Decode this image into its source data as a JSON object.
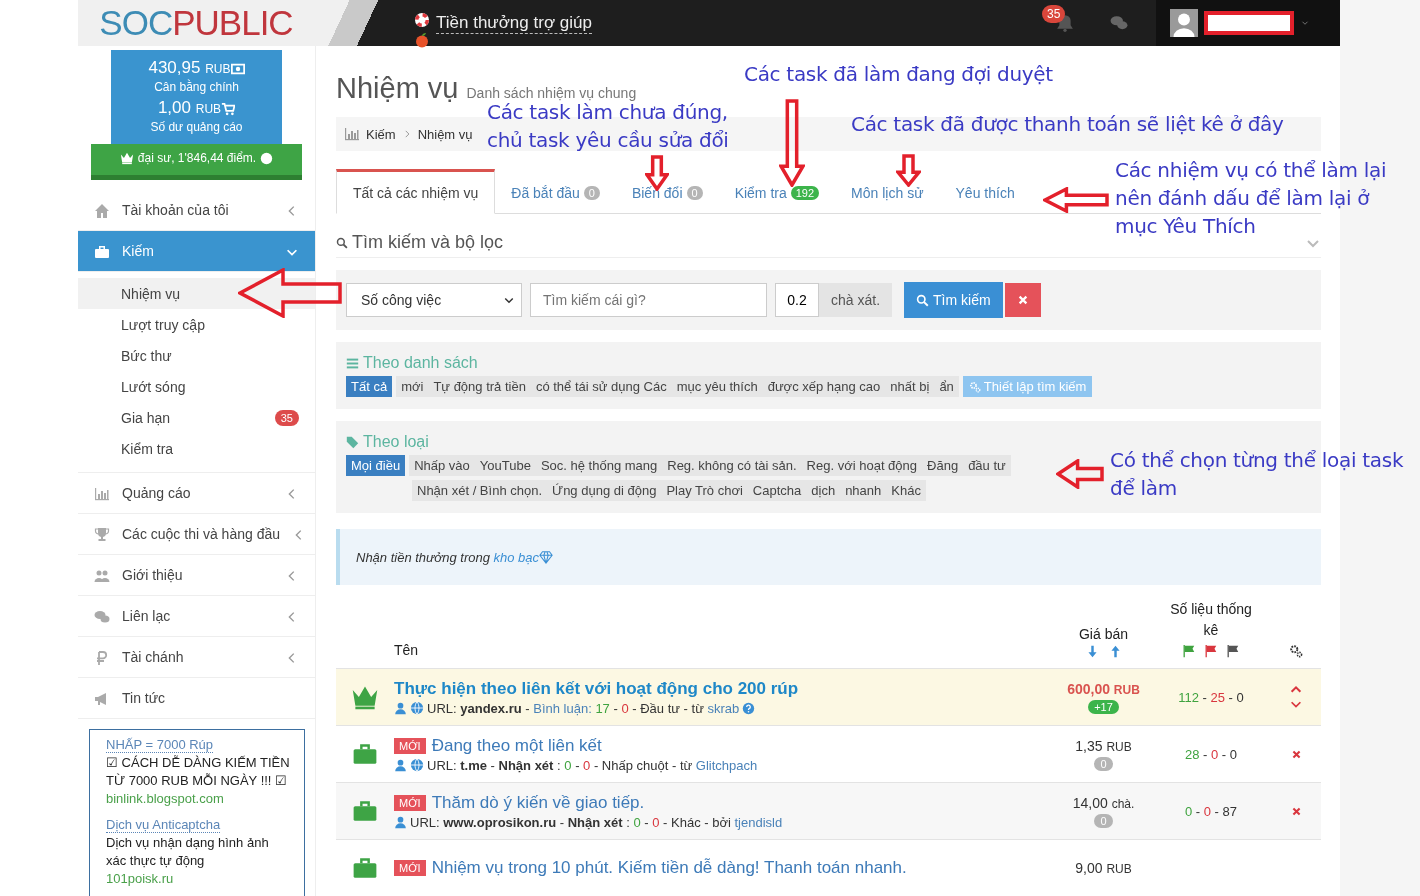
{
  "header": {
    "logo_left": "SOC",
    "logo_right": "PUBLIC",
    "bonus_link": "Tiền thưởng trợ giúp",
    "notification_count": "35"
  },
  "balance": {
    "main_amount": "430,95",
    "main_currency": "RUB",
    "main_label": "Cân bằng chính",
    "ad_amount": "1,00",
    "ad_currency": "RUB",
    "ad_label": "Số dư quảng cáo",
    "rank": "đại sư, 1'846,44 điểm."
  },
  "sidebar": {
    "items": [
      {
        "label": "Tài khoản của tôi",
        "kind": "group",
        "expanded": false,
        "selected": false
      },
      {
        "label": "Kiếm",
        "kind": "group",
        "expanded": true,
        "selected": true,
        "children": [
          {
            "label": "Nhiệm vụ",
            "selected": true
          },
          {
            "label": "Lượt truy cập",
            "selected": false
          },
          {
            "label": "Bức thư",
            "selected": false
          },
          {
            "label": "Lướt sóng",
            "selected": false
          },
          {
            "label": "Gia hạn",
            "selected": false,
            "badge": "35"
          },
          {
            "label": "Kiểm tra",
            "selected": false
          }
        ]
      },
      {
        "label": "Quảng cáo",
        "kind": "group",
        "expanded": false,
        "selected": false
      },
      {
        "label": "Các cuộc thi và hàng đầu",
        "kind": "group",
        "expanded": false,
        "selected": false
      },
      {
        "label": "Giới thiệu",
        "kind": "group",
        "expanded": false,
        "selected": false
      },
      {
        "label": "Liên lạc",
        "kind": "group",
        "expanded": false,
        "selected": false
      },
      {
        "label": "Tài chánh",
        "kind": "group",
        "expanded": false,
        "selected": false
      },
      {
        "label": "Tin tức",
        "kind": "link",
        "selected": false
      }
    ],
    "ads": [
      {
        "title": "NHẤP = 7000 Rúp",
        "body": "☑ CÁCH DỄ DÀNG KIẾM TIỀN TỪ 7000 RUB MỖI NGÀY !!! ☑",
        "url": "binlink.blogspot.com"
      },
      {
        "title": "Dịch vụ Anticaptcha",
        "body": "Dịch vụ nhận dạng hình ảnh xác thực tự động",
        "url": "101poisk.ru"
      }
    ]
  },
  "page": {
    "title": "Nhiệm vụ",
    "subtitle": "Danh sách nhiệm vụ chung",
    "breadcrumb": [
      "Kiếm",
      "Nhiệm vụ"
    ]
  },
  "tabs": [
    {
      "label": "Tất cả các nhiệm vụ",
      "selected": true
    },
    {
      "label": "Đã bắt đầu",
      "selected": false,
      "badge": {
        "text": "0",
        "color": "#b5b5b5"
      }
    },
    {
      "label": "Biến đổi",
      "selected": false,
      "badge": {
        "text": "0",
        "color": "#b5b5b5"
      }
    },
    {
      "label": "Kiểm tra",
      "selected": false,
      "badge": {
        "text": "192",
        "color": "#3cb44b"
      }
    },
    {
      "label": "Môn lịch sử",
      "selected": false
    },
    {
      "label": "Yêu thích",
      "selected": false
    }
  ],
  "search": {
    "title": "Tìm kiếm và bộ lọc",
    "select_value": "Số công việc",
    "placeholder": "Tìm kiếm cái gì?",
    "amount": "0.2",
    "unit": "chà xát.",
    "button": "Tìm kiếm"
  },
  "list_filter": {
    "title": "Theo danh sách",
    "options": [
      {
        "label": "Tất cả",
        "selected": true
      },
      {
        "label": "mới",
        "selected": false
      },
      {
        "label": "Tự động trả tiền",
        "selected": false
      },
      {
        "label": "có thể tái sử dụng Các",
        "selected": false
      },
      {
        "label": "mục yêu thích",
        "selected": false
      },
      {
        "label": "được xếp hạng cao",
        "selected": false
      },
      {
        "label": "nhất bị",
        "selected": false
      },
      {
        "label": "ẩn",
        "selected": false
      }
    ],
    "settings_button": "Thiết lập tìm kiếm"
  },
  "type_filter": {
    "title": "Theo loại",
    "option_rows": [
      [
        {
          "label": "Mọi điều",
          "selected": true
        },
        {
          "label": "Nhấp vào",
          "selected": false
        },
        {
          "label": "YouTube",
          "selected": false
        },
        {
          "label": "Soc. hệ thống mang",
          "selected": false
        },
        {
          "label": "Reg. không có tài sản.",
          "selected": false
        },
        {
          "label": "Reg. với hoạt động",
          "selected": false
        },
        {
          "label": "Đăng",
          "selected": false
        },
        {
          "label": "đầu tư",
          "selected": false
        }
      ],
      [
        {
          "label": "Nhận xét / Bình chọn.",
          "selected": false
        },
        {
          "label": "Ứng dụng di động",
          "selected": false
        },
        {
          "label": "Play Trò chơi",
          "selected": false
        },
        {
          "label": "Captcha",
          "selected": false
        },
        {
          "label": "dịch",
          "selected": false
        },
        {
          "label": "nhanh",
          "selected": false
        },
        {
          "label": "Khác",
          "selected": false
        }
      ]
    ]
  },
  "notice": {
    "text": "Nhận tiền thưởng trong ",
    "link": "kho bạc"
  },
  "table": {
    "columns": [
      "Tên",
      "Giá bán",
      "Số liệu thống kê"
    ],
    "rows": [
      {
        "kind": "premium",
        "title": "Thực hiện theo liên kết với hoạt động cho 200 rúp",
        "website_icon": true,
        "help_icon": true,
        "meta": [
          {
            "text": "URL: ",
            "kind": "text"
          },
          {
            "text": "yandex.ru",
            "kind": "bold"
          },
          {
            "text": " - ",
            "kind": "text"
          },
          {
            "text": "Bình luận: ",
            "kind": "link"
          },
          {
            "text": "17",
            "kind": "good"
          },
          {
            "text": " - ",
            "kind": "text"
          },
          {
            "text": "0",
            "kind": "bad"
          },
          {
            "text": " - Đầu tư - từ ",
            "kind": "text"
          },
          {
            "text": "skrab",
            "kind": "link"
          }
        ],
        "price": "600,00",
        "currency": "RUB",
        "bonus": {
          "text": "+17",
          "color": "#3cb44b"
        },
        "stats": [
          "112",
          " - ",
          "25",
          " - ",
          "0"
        ]
      },
      {
        "kind": "task",
        "tag": "MỚI",
        "title": "Đang theo một liên kết",
        "website_icon": true,
        "help_icon": false,
        "meta": [
          {
            "text": "URL: ",
            "kind": "text"
          },
          {
            "text": "t.me",
            "kind": "bold"
          },
          {
            "text": " - ",
            "kind": "text"
          },
          {
            "text": "Nhận xét",
            "kind": "bold"
          },
          {
            "text": " : ",
            "kind": "text"
          },
          {
            "text": "0",
            "kind": "good"
          },
          {
            "text": " - ",
            "kind": "text"
          },
          {
            "text": "0",
            "kind": "bad"
          },
          {
            "text": " - Nhấp chuột - từ ",
            "kind": "text"
          },
          {
            "text": "Glitchpach",
            "kind": "link"
          }
        ],
        "price": "1,35",
        "currency": "RUB",
        "bonus": {
          "text": "0",
          "color": "#b5b5b5"
        },
        "stats": [
          "28",
          " - ",
          "0",
          " - ",
          "0"
        ]
      },
      {
        "kind": "task",
        "tag": "MỚI",
        "title": "Thăm dò ý kiến về giao tiếp.",
        "website_icon": false,
        "help_icon": false,
        "meta": [
          {
            "text": "URL: ",
            "kind": "text"
          },
          {
            "text": "www.oprosikon.ru",
            "kind": "bold"
          },
          {
            "text": " - ",
            "kind": "text"
          },
          {
            "text": "Nhận xét",
            "kind": "bold"
          },
          {
            "text": " : ",
            "kind": "text"
          },
          {
            "text": "0",
            "kind": "good"
          },
          {
            "text": " - ",
            "kind": "text"
          },
          {
            "text": "0",
            "kind": "bad"
          },
          {
            "text": " - Khác - bởi ",
            "kind": "text"
          },
          {
            "text": "tjendisld",
            "kind": "link"
          }
        ],
        "price": "14,00",
        "currency": "chà.",
        "bonus": {
          "text": "0",
          "color": "#b5b5b5"
        },
        "stats": [
          "0",
          " - ",
          "0",
          " - ",
          "87"
        ]
      },
      {
        "kind": "task",
        "tag": "MỚI",
        "title": "Nhiệm vụ trong 10 phút. Kiếm tiền dễ dàng! Thanh toán nhanh.",
        "price": "9,00",
        "currency": "RUB"
      }
    ]
  },
  "annotations": [
    {
      "text": "Các task đã làm đang đợi duyệt"
    },
    {
      "text": "Các task làm chưa đúng,\nchủ task yêu cầu sửa đổi"
    },
    {
      "text": "Các task đã được thanh toán sẽ liệt kê ở đây"
    },
    {
      "text": "Các nhiệm vụ có thể làm lại\nnên đánh dấu để làm lại ở\nmục Yêu Thích"
    },
    {
      "text": "Có thể chọn từng thể loại task\nđể làm"
    }
  ]
}
